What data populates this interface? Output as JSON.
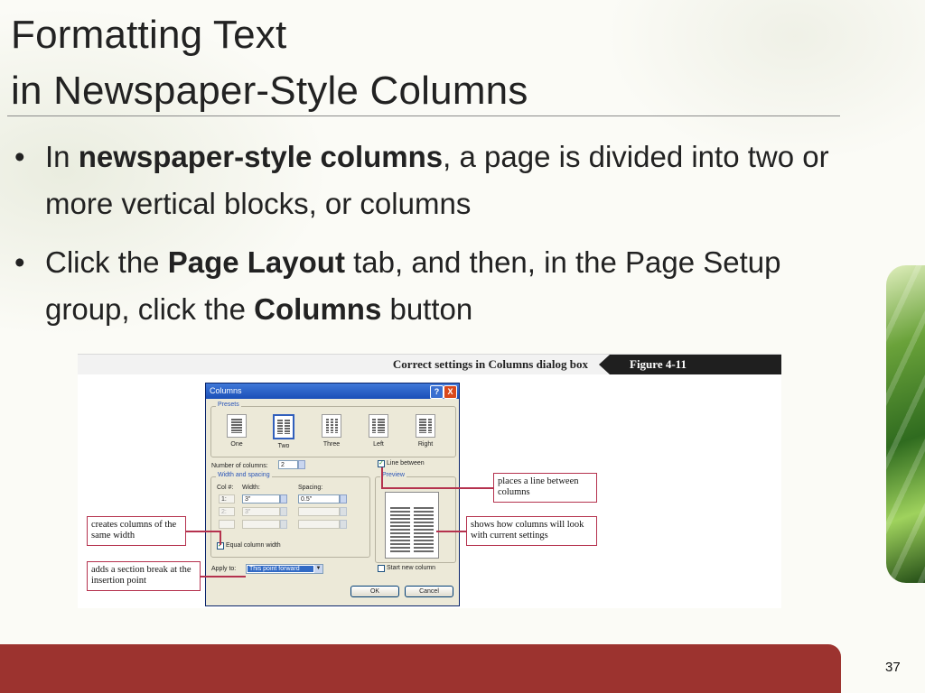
{
  "slide": {
    "title_line1": "Formatting Text",
    "title_line2": "in Newspaper-Style Columns",
    "bullets": [
      {
        "pre": "In ",
        "bold": "newspaper-style columns",
        "post": ", a page is divided into two or more vertical blocks, or columns"
      },
      {
        "pre": "Click the ",
        "bold": "Page Layout",
        "mid": " tab, and then, in the Page Setup group, click the ",
        "bold2": "Columns",
        "post": " button"
      }
    ],
    "page_number": "37",
    "accent_color": "#9c332f"
  },
  "figure": {
    "caption": "Correct settings in Columns dialog box",
    "tag": "Figure  4-11",
    "callouts": {
      "line_between": "places a line between columns",
      "preview": "shows how columns will look with current settings",
      "equal_width": "creates columns of the same width",
      "section_break": "adds a section break at the insertion point"
    },
    "dialog": {
      "title": "Columns",
      "help": "?",
      "close": "X",
      "presets_label": "Presets",
      "presets": [
        "One",
        "Two",
        "Three",
        "Left",
        "Right"
      ],
      "selected_preset": "Two",
      "num_columns_label": "Number of columns:",
      "num_columns_value": "2",
      "line_between_label": "Line between",
      "line_between_checked": true,
      "preview_label": "Preview",
      "width_spacing_label": "Width and spacing",
      "col_header": "Col #:",
      "width_header": "Width:",
      "spacing_header": "Spacing:",
      "rows": [
        {
          "col": "1:",
          "width": "3\"",
          "spacing": "0.5\""
        },
        {
          "col": "2:",
          "width": "3\"",
          "spacing": ""
        },
        {
          "col": "",
          "width": "",
          "spacing": ""
        }
      ],
      "equal_width_label": "Equal column width",
      "equal_width_checked": true,
      "apply_to_label": "Apply to:",
      "apply_to_value": "This point forward",
      "start_new_column_label": "Start new column",
      "ok": "OK",
      "cancel": "Cancel"
    }
  }
}
